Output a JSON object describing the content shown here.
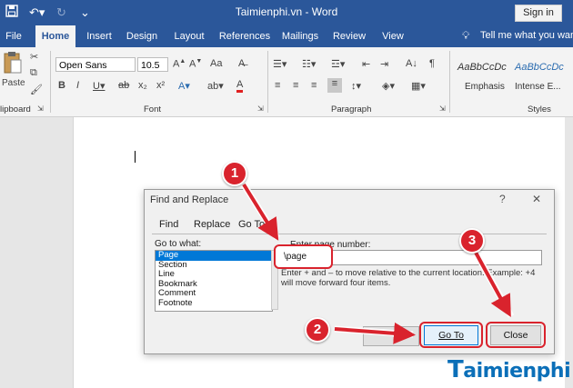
{
  "window": {
    "title": "Taimienphi.vn  -  Word",
    "sign_in": "Sign in"
  },
  "ribbon_tabs": [
    "File",
    "Home",
    "Insert",
    "Design",
    "Layout",
    "References",
    "Mailings",
    "Review",
    "View"
  ],
  "tell_me": "Tell me what you want t",
  "ribbon": {
    "clipboard_label": "lipboard",
    "paste_label": "Paste",
    "font_label": "Font",
    "paragraph_label": "Paragraph",
    "styles_label": "Styles",
    "font_name": "Open Sans",
    "font_size": "10.5",
    "style_preview_1": "AaBbCcDc",
    "style_preview_2": "AaBbCcDc",
    "style_name_1": "Emphasis",
    "style_name_2": "Intense E..."
  },
  "dialog": {
    "title": "Find and Replace",
    "help": "?",
    "close": "✕",
    "tabs": [
      "Find",
      "Replace",
      "Go To"
    ],
    "goto_what_label": "Go to what:",
    "goto_items": [
      "Page",
      "Section",
      "Line",
      "Bookmark",
      "Comment",
      "Footnote"
    ],
    "enter_label": "Enter page number:",
    "page_value": "\\page",
    "hint": "Enter + and – to move relative to the current location. Example: +4 will move forward four items.",
    "goto_button": "Go To",
    "close_button": "Close"
  },
  "annotations": [
    "1",
    "2",
    "3"
  ],
  "watermark": "aimienphi",
  "colors": {
    "word_blue": "#2b579a",
    "annotation_red": "#d9232d",
    "selection_blue": "#0078d7"
  }
}
